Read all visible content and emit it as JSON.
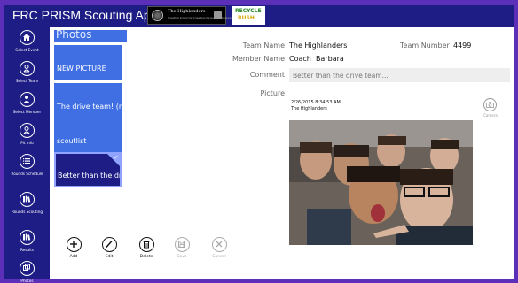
{
  "app": {
    "title": "FRC PRISM Scouting App",
    "logos": {
      "highlanders_name": "The Highlanders",
      "highlanders_tag": "Creating tomorrow's leaders through technology",
      "recycle_line1": "RECYCLE",
      "recycle_line2": "RUSH"
    }
  },
  "nav": [
    {
      "label": "Select Event",
      "icon": "home-icon"
    },
    {
      "label": "Select Team",
      "icon": "team-icon"
    },
    {
      "label": "Select Member",
      "icon": "member-icon"
    },
    {
      "label": "Pit Info",
      "icon": "pit-info-icon"
    },
    {
      "label": "Rounds Schedule",
      "icon": "schedule-icon"
    },
    {
      "label": "Rounds Scouting",
      "icon": "scouting-icon"
    },
    {
      "label": "Results",
      "icon": "results-icon"
    },
    {
      "label": "Photos",
      "icon": "photos-icon"
    }
  ],
  "photos": {
    "header": "Photos",
    "items": [
      {
        "label": "NEW PICTURE",
        "selected": false
      },
      {
        "label": "The drive team! (n",
        "selected": false
      },
      {
        "label": "scoutlist",
        "selected": false
      },
      {
        "label": "Better than the dri",
        "selected": true
      }
    ]
  },
  "appbar": [
    {
      "label": "Add",
      "icon": "add-icon",
      "enabled": true
    },
    {
      "label": "Edit",
      "icon": "edit-icon",
      "enabled": true
    },
    {
      "label": "Delete",
      "icon": "delete-icon",
      "enabled": true
    },
    {
      "label": "Save",
      "icon": "save-icon",
      "enabled": false
    },
    {
      "label": "Cancel",
      "icon": "cancel-icon",
      "enabled": false
    }
  ],
  "detail": {
    "team_name_label": "Team Name",
    "team_name_value": "The Highlanders",
    "team_number_label": "Team Number",
    "team_number_value": "4499",
    "member_name_label": "Member Name",
    "member_name_value": "Coach  Barbara",
    "comment_label": "Comment",
    "comment_value": "Better than the drive team...",
    "picture_label": "Picture",
    "picture_date": "2/26/2015 8:34:53 AM",
    "picture_team": "The Highlanders",
    "camera_label": "Camera"
  },
  "colors": {
    "accent": "#1d1d85",
    "tile": "#3f6fe3",
    "border": "#5b2fb8"
  }
}
